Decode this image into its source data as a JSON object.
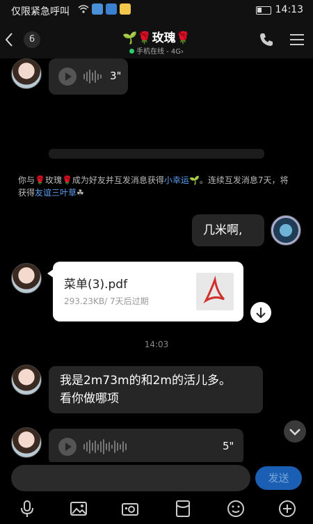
{
  "status_bar": {
    "carrier_text": "仅限紧急呼叫",
    "time": "14:13"
  },
  "header": {
    "back_icon": "chevron-left-icon",
    "unread_count": "6",
    "title": "🌱🌹玫瑰🌹",
    "subtitle": "手机在线 - 4G",
    "subtitle_chevron": "›"
  },
  "messages": {
    "voice_1_duration": "3\"",
    "system_notice_parts": {
      "p1": "你与",
      "p2": "🌹玫瑰🌹",
      "p3": "成为好友并互发消息获得",
      "link1": "小幸运",
      "p4": "🌱。连续互发消息7天，将获得",
      "link2": "友谊三叶草",
      "p5": "☘"
    },
    "outgoing_text": "几米啊,",
    "file": {
      "name": "菜单(3).pdf",
      "meta": "293.23KB/ 7天后过期"
    },
    "timestamp": "14:03",
    "incoming_text_line1": "我是2m73m的和2m的活儿多。",
    "incoming_text_line2": "看你做哪项",
    "voice_2_duration": "5\""
  },
  "input": {
    "placeholder": "",
    "send_label": "发送"
  },
  "toolbar": {
    "icons": [
      "microphone-icon",
      "image-icon",
      "camera-icon",
      "red-packet-icon",
      "emoji-icon",
      "plus-icon"
    ]
  },
  "colors": {
    "accent": "#1a5fb4",
    "link": "#5a9ff0",
    "online": "#2ecc71"
  }
}
